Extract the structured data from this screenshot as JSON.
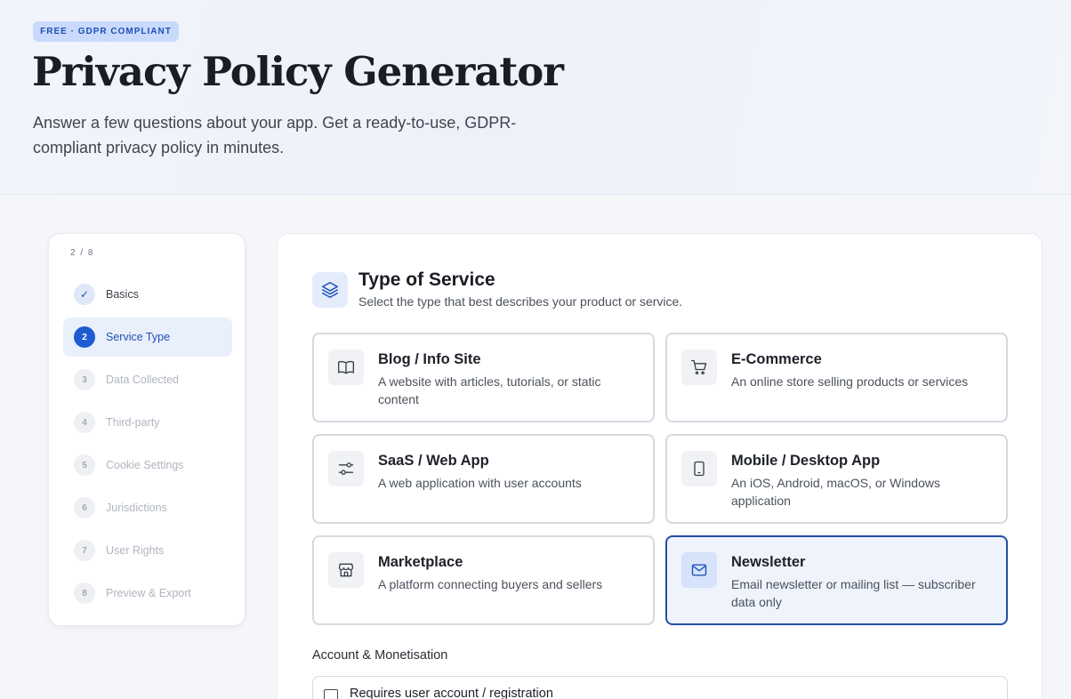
{
  "hero": {
    "badge": "FREE · GDPR COMPLIANT",
    "title": "Privacy Policy Generator",
    "subtitle": "Answer a few questions about your app. Get a ready-to-use, GDPR-compliant privacy policy in minutes."
  },
  "stepper": {
    "progress": "2 / 8",
    "steps": [
      {
        "marker": "✓",
        "label": "Basics",
        "state": "done"
      },
      {
        "marker": "2",
        "label": "Service Type",
        "state": "current"
      },
      {
        "marker": "3",
        "label": "Data Collected",
        "state": "todo"
      },
      {
        "marker": "4",
        "label": "Third-party",
        "state": "todo"
      },
      {
        "marker": "5",
        "label": "Cookie Settings",
        "state": "todo"
      },
      {
        "marker": "6",
        "label": "Jurisdictions",
        "state": "todo"
      },
      {
        "marker": "7",
        "label": "User Rights",
        "state": "todo"
      },
      {
        "marker": "8",
        "label": "Preview & Export",
        "state": "todo"
      }
    ]
  },
  "section": {
    "icon": "layers-icon",
    "title": "Type of Service",
    "subtitle": "Select the type that best describes your product or service.",
    "options": [
      {
        "icon": "book-icon",
        "title": "Blog / Info Site",
        "desc": "A website with articles, tutorials, or static content",
        "selected": false
      },
      {
        "icon": "cart-icon",
        "title": "E-Commerce",
        "desc": "An online store selling products or services",
        "selected": false
      },
      {
        "icon": "sliders-icon",
        "title": "SaaS / Web App",
        "desc": "A web application with user accounts",
        "selected": false
      },
      {
        "icon": "tablet-icon",
        "title": "Mobile / Desktop App",
        "desc": "An iOS, Android, macOS, or Windows application",
        "selected": false
      },
      {
        "icon": "store-icon",
        "title": "Marketplace",
        "desc": "A platform connecting buyers and sellers",
        "selected": false
      },
      {
        "icon": "mail-icon",
        "title": "Newsletter",
        "desc": "Email newsletter or mailing list — subscriber data only",
        "selected": true
      }
    ]
  },
  "account": {
    "group_label": "Account & Monetisation",
    "requires_account_label": "Requires user account / registration",
    "requires_account_checked": false
  },
  "colors": {
    "accent": "#1f5bd1",
    "selected_border": "#244fa6",
    "badge_bg": "#c9dafd"
  }
}
